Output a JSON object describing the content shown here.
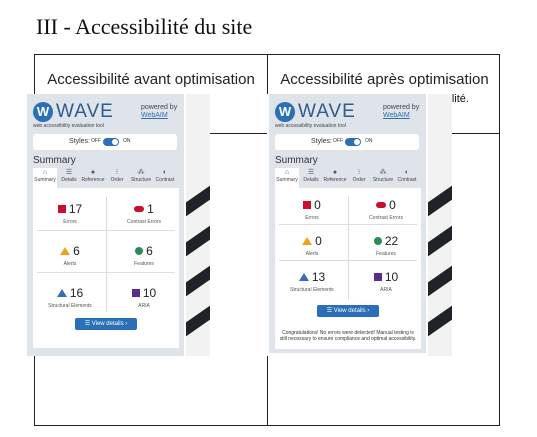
{
  "heading": "III - Accessibilité du site",
  "columns": {
    "left_title": "Accessibilité avant optimisation",
    "right_title": "Accessibilité après optimisation",
    "right_note": "Il n'y a plus d'erreur d'accessibilité."
  },
  "wave": {
    "logo": "W",
    "name": "WAVE",
    "tagline": "web accessibility evaluation tool",
    "powered_by": "powered by",
    "webaim": "WebAIM",
    "styles_label": "Styles:",
    "styles_off": "OFF",
    "styles_on": "ON",
    "summary_title": "Summary",
    "tabs": [
      "Summary",
      "Details",
      "Reference",
      "Order",
      "Structure",
      "Contrast"
    ],
    "tab_icons": [
      "home-icon",
      "list-icon",
      "info-icon",
      "order-icon",
      "structure-icon",
      "contrast-icon"
    ],
    "view_details": "☰  View details ›",
    "captions": {
      "errors": "Errors",
      "contrast": "Contrast Errors",
      "alerts": "Alerts",
      "features": "Features",
      "structural": "Structural Elements",
      "aria": "ARIA"
    }
  },
  "before": {
    "errors": "17",
    "contrast": "1",
    "alerts": "6",
    "features": "6",
    "structural": "16",
    "aria": "10"
  },
  "after": {
    "errors": "0",
    "contrast": "0",
    "alerts": "0",
    "features": "22",
    "structural": "13",
    "aria": "10",
    "congrats": "Congratulations! No errors were detected! Manual testing is still necessary to ensure compliance and optimal accessibility."
  },
  "colors": {
    "wave_blue": "#2b6fb6",
    "error_red": "#c8102e",
    "alert_orange": "#f0a31a",
    "feature_green": "#2e8b57",
    "aria_purple": "#5b2c8a"
  }
}
